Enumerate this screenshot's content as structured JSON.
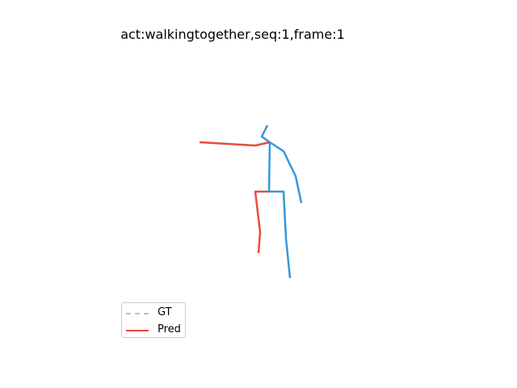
{
  "colors": {
    "gt": "#c0c0c0",
    "pred_left": "#e74c3c",
    "pred_right": "#3498db"
  },
  "chart_data": {
    "type": "line",
    "title": "act:walkingtogether,seq:1,frame:1",
    "xlabel": "",
    "ylabel": "",
    "axes_visible": false,
    "legend": {
      "placement": "lower-left",
      "entries": [
        {
          "label": "GT",
          "style": "dashed",
          "color": "#c0c0c0"
        },
        {
          "label": "Pred",
          "style": "solid",
          "color": "#e74c3c"
        }
      ]
    },
    "series": [
      {
        "name": "Pred",
        "bones": [
          {
            "side": "right",
            "points": [
              [
                333,
                237
              ],
              [
                351,
                237
              ],
              [
                354,
                295
              ],
              [
                359,
                344
              ]
            ]
          },
          {
            "side": "left",
            "points": [
              [
                333,
                237
              ],
              [
                316,
                237
              ],
              [
                322,
                287
              ],
              [
                320,
                313
              ]
            ]
          },
          {
            "side": "right",
            "points": [
              [
                333,
                237
              ],
              [
                334,
                176
              ]
            ]
          },
          {
            "side": "right",
            "points": [
              [
                334,
                176
              ],
              [
                324,
                169
              ],
              [
                331,
                155
              ]
            ]
          },
          {
            "side": "left",
            "points": [
              [
                334,
                176
              ],
              [
                316,
                180
              ],
              [
                247,
                176
              ]
            ]
          },
          {
            "side": "right",
            "points": [
              [
                334,
                176
              ],
              [
                351,
                187
              ],
              [
                366,
                218
              ],
              [
                373,
                251
              ]
            ]
          }
        ]
      }
    ]
  }
}
